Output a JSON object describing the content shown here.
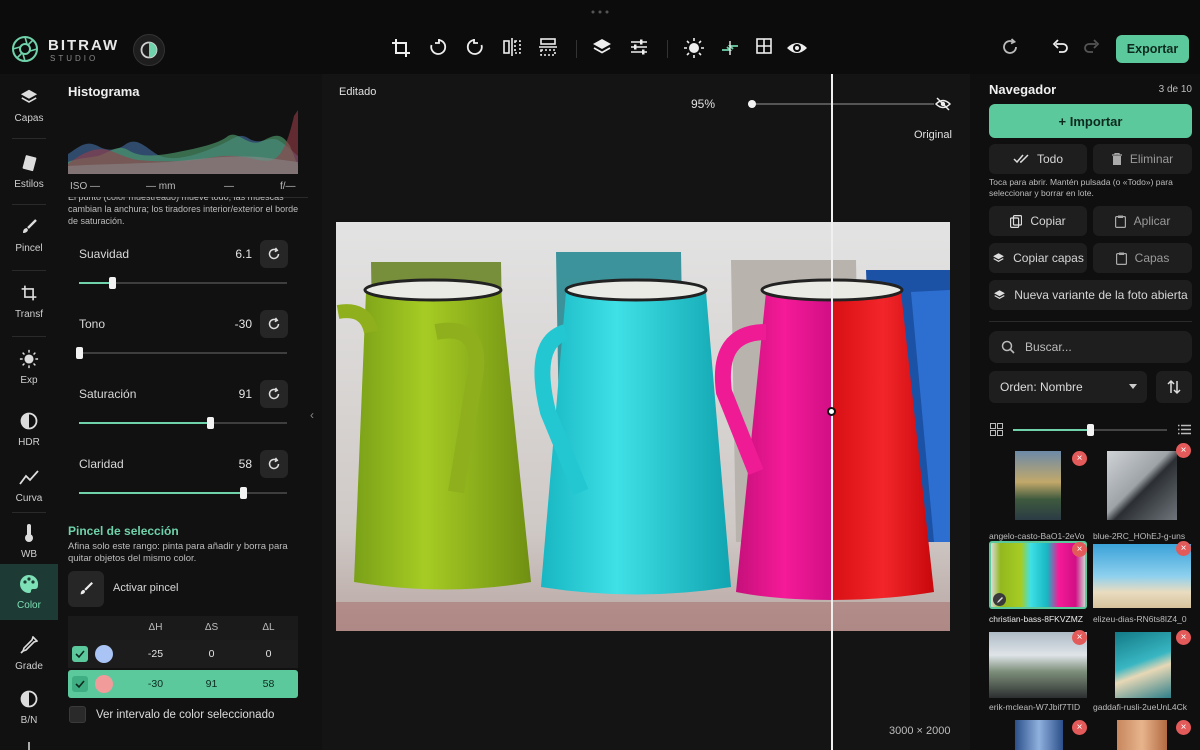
{
  "app": {
    "brand": "BITRAW",
    "brand_sub": "STUDIO"
  },
  "toolbar": {
    "export_label": "Exportar",
    "accent": "#5cc99c"
  },
  "rail": {
    "items": [
      {
        "label": "Capas",
        "icon": "layers-icon"
      },
      {
        "label": "Estilos",
        "icon": "styles-icon"
      },
      {
        "label": "Pincel",
        "icon": "brush-icon"
      },
      {
        "label": "Transf",
        "icon": "crop-icon"
      },
      {
        "label": "Exp",
        "icon": "sun-icon"
      },
      {
        "label": "HDR",
        "icon": "hdr-icon"
      },
      {
        "label": "Curva",
        "icon": "curve-icon"
      },
      {
        "label": "WB",
        "icon": "thermometer-icon"
      },
      {
        "label": "Color",
        "icon": "palette-icon"
      },
      {
        "label": "Grade",
        "icon": "dropper-icon"
      },
      {
        "label": "B/N",
        "icon": "bw-icon"
      }
    ]
  },
  "histogram": {
    "title": "Histograma",
    "iso": "ISO —",
    "mm": "— mm",
    "dash": "—",
    "f": "f/—"
  },
  "left": {
    "intro_text": "El punto (color muestreado) mueve todo; las muescas cambian la anchura; los tiradores interior/exterior el borde de saturación.",
    "controls": [
      {
        "label": "Suavidad",
        "value": "6.1",
        "level": 0.16
      },
      {
        "label": "Tono",
        "value": "-30",
        "level": 0.0
      },
      {
        "label": "Saturación",
        "value": "91",
        "level": 0.63
      },
      {
        "label": "Claridad",
        "value": "58",
        "level": 0.79
      }
    ],
    "brush_title": "Pincel de selección",
    "brush_desc": "Afina solo este rango: pinta para añadir y borra para quitar objetos del mismo color.",
    "brush_button": "Activar pincel",
    "table_headers": [
      "ΔH",
      "ΔS",
      "ΔL"
    ],
    "rows": [
      {
        "swatch": "#a9c4f5",
        "dh": "-25",
        "ds": "0",
        "dl": "0",
        "selected": false
      },
      {
        "swatch": "#f19b9b",
        "dh": "-30",
        "ds": "91",
        "dl": "58",
        "selected": true
      }
    ],
    "show_range_label": "Ver intervalo de color seleccionado"
  },
  "canvas": {
    "edited_label": "Editado",
    "original_label": "Original",
    "zoom": "95%",
    "dimensions": "3000 × 2000"
  },
  "nav": {
    "title": "Navegador",
    "count": "3 de 10",
    "import_label": "+ Importar",
    "all_label": "Todo",
    "delete_label": "Eliminar",
    "hint": "Toca para abrir. Mantén pulsada (o «Todo») para seleccionar y borrar en lote.",
    "copy_label": "Copiar",
    "apply_label": "Aplicar",
    "copy_layers_label": "Copiar capas",
    "layers_label": "Capas",
    "new_variant_label": "Nueva variante de la foto abierta",
    "search_placeholder": "Buscar...",
    "sort_label": "Orden: Nombre",
    "thumb_size": 0.5,
    "thumbs": [
      {
        "name": "angelo-casto-BaO1-2eVo"
      },
      {
        "name": "blue-2RC_HOhEJ-g-uns"
      },
      {
        "name": "christian-bass-8FKVZMZ"
      },
      {
        "name": "elizeu-dias-RN6ts8IZ4_0"
      },
      {
        "name": "erik-mclean-W7Jbif7TID"
      },
      {
        "name": "gaddafi-rusli-2ueUnL4Ck"
      }
    ]
  }
}
